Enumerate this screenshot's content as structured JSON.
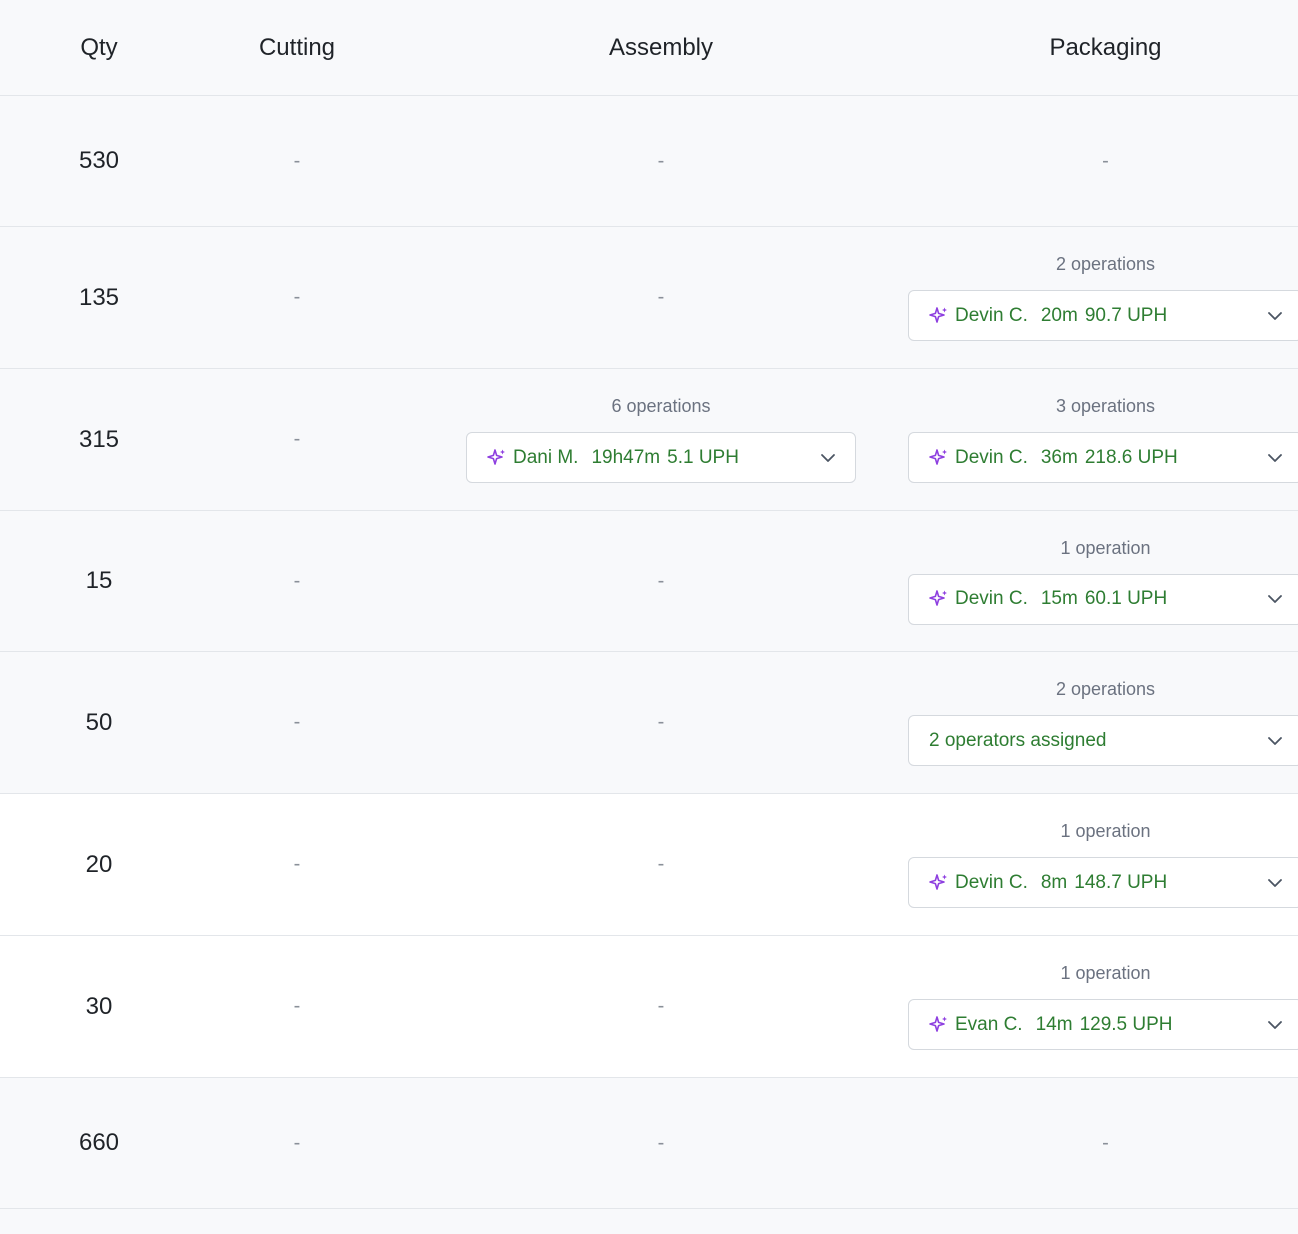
{
  "header": {
    "qty": "Qty",
    "cutting": "Cutting",
    "assembly": "Assembly",
    "packaging": "Packaging"
  },
  "colors": {
    "operator_text": "#2e7d32",
    "sparkle_icon": "#8e3fe0",
    "muted": "#6b7280"
  },
  "rows": [
    {
      "qty": "530",
      "cutting": "-",
      "assembly": {
        "empty": "-"
      },
      "packaging": {
        "empty": "-"
      }
    },
    {
      "qty": "135",
      "cutting": "-",
      "assembly": {
        "empty": "-"
      },
      "packaging": {
        "ops": "2 operations",
        "name": "Devin C.",
        "time": "20m",
        "uph": "90.7 UPH",
        "icon": "sparkle-icon"
      }
    },
    {
      "qty": "315",
      "cutting": "-",
      "assembly": {
        "ops": "6 operations",
        "name": "Dani M.",
        "time": "19h47m",
        "uph": "5.1 UPH",
        "icon": "sparkle-icon"
      },
      "packaging": {
        "ops": "3 operations",
        "name": "Devin C.",
        "time": "36m",
        "uph": "218.6 UPH",
        "icon": "sparkle-icon"
      }
    },
    {
      "qty": "15",
      "cutting": "-",
      "assembly": {
        "empty": "-"
      },
      "packaging": {
        "ops": "1 operation",
        "name": "Devin C.",
        "time": "15m",
        "uph": "60.1 UPH",
        "icon": "sparkle-icon"
      }
    },
    {
      "qty": "50",
      "cutting": "-",
      "assembly": {
        "empty": "-"
      },
      "packaging": {
        "ops": "2 operations",
        "summary": "2 operators assigned"
      }
    },
    {
      "qty": "20",
      "cutting": "-",
      "assembly": {
        "empty": "-"
      },
      "packaging": {
        "ops": "1 operation",
        "name": "Devin C.",
        "time": "8m",
        "uph": "148.7 UPH",
        "icon": "sparkle-icon"
      }
    },
    {
      "qty": "30",
      "cutting": "-",
      "assembly": {
        "empty": "-"
      },
      "packaging": {
        "ops": "1 operation",
        "name": "Evan C.",
        "time": "14m",
        "uph": "129.5 UPH",
        "icon": "sparkle-icon"
      }
    },
    {
      "qty": "660",
      "cutting": "-",
      "assembly": {
        "empty": "-"
      },
      "packaging": {
        "empty": "-"
      }
    }
  ]
}
